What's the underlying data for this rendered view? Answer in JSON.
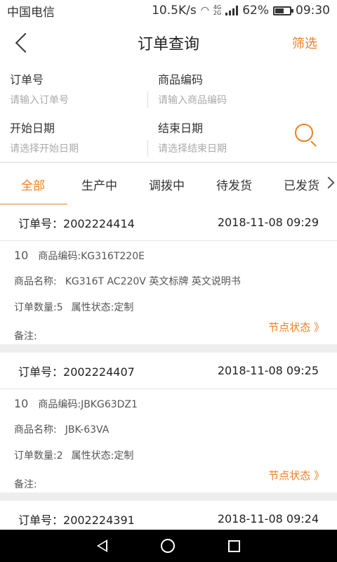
{
  "statusbar": {
    "carrier": "中国电信",
    "speed": "10.5K/s",
    "network": "4G",
    "network2": "2G",
    "battery": "62%",
    "battery_level": 0.62,
    "time": "09:30"
  },
  "header": {
    "title": "订单查询",
    "filter_label": "筛选"
  },
  "form": {
    "order_no_label": "订单号",
    "order_no_placeholder": "请输入订单号",
    "product_code_label": "商品编码",
    "product_code_placeholder": "请输入商品编码",
    "start_date_label": "开始日期",
    "start_date_placeholder": "请选择开始日期",
    "end_date_label": "结束日期",
    "end_date_placeholder": "请选择结束日期"
  },
  "tabs": [
    "全部",
    "生产中",
    "调拨中",
    "待发货",
    "已发货"
  ],
  "orders": [
    {
      "order_label": "订单号：",
      "order_no": "2002224414",
      "datetime": "2018-11-08 09:29",
      "qty_num": "10",
      "code": "商品编码:KG316T220E",
      "name_label": "商品名称:",
      "name": "KG316T  AC220V 英文标牌 英文说明书",
      "order_qty": "订单数量:5",
      "attr": "属性状态:定制",
      "remark": "备注:",
      "node_status": "节点状态 》"
    },
    {
      "order_label": "订单号：",
      "order_no": "2002224407",
      "datetime": "2018-11-08 09:25",
      "qty_num": "10",
      "code": "商品编码:JBKG63DZ1",
      "name_label": "商品名称:",
      "name": "JBK-63VA",
      "order_qty": "订单数量:2",
      "attr": "属性状态:定制",
      "remark": "备注:",
      "node_status": "节点状态 》"
    },
    {
      "order_label": "订单号：",
      "order_no": "2002224391",
      "datetime": "2018-11-08 09:24"
    }
  ]
}
